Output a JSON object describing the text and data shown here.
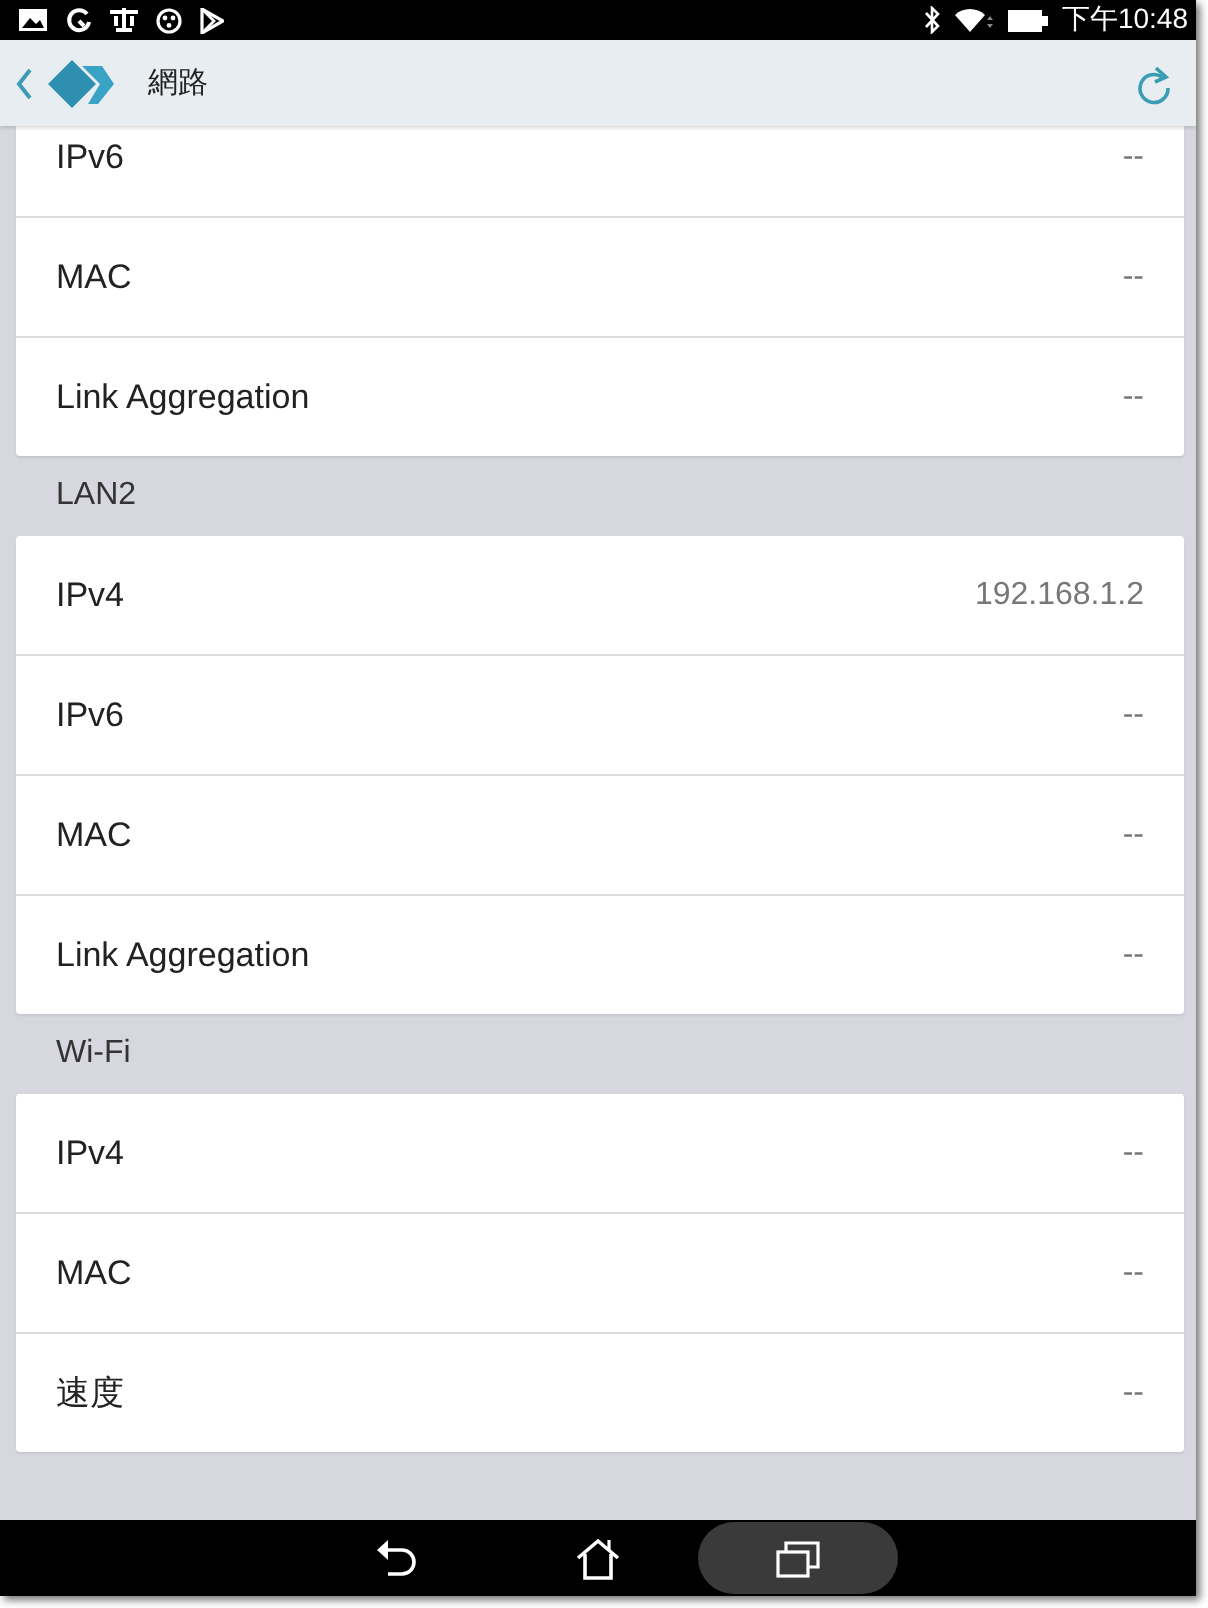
{
  "status_bar": {
    "time": "下午10:48"
  },
  "header": {
    "title": "網路"
  },
  "sections": [
    {
      "rows": [
        {
          "label": "IPv6",
          "value": "--"
        },
        {
          "label": "MAC",
          "value": "--"
        },
        {
          "label": "Link Aggregation",
          "value": "--"
        }
      ]
    },
    {
      "title": "LAN2",
      "rows": [
        {
          "label": "IPv4",
          "value": "192.168.1.2"
        },
        {
          "label": "IPv6",
          "value": "--"
        },
        {
          "label": "MAC",
          "value": "--"
        },
        {
          "label": "Link Aggregation",
          "value": "--"
        }
      ]
    },
    {
      "title": "Wi-Fi",
      "rows": [
        {
          "label": "IPv4",
          "value": "--"
        },
        {
          "label": "MAC",
          "value": "--"
        },
        {
          "label": "速度",
          "value": "--"
        }
      ]
    }
  ],
  "nav_bar": [
    {
      "kind": "back",
      "selected": false
    },
    {
      "kind": "home",
      "selected": false
    },
    {
      "kind": "recents",
      "selected": true
    }
  ]
}
